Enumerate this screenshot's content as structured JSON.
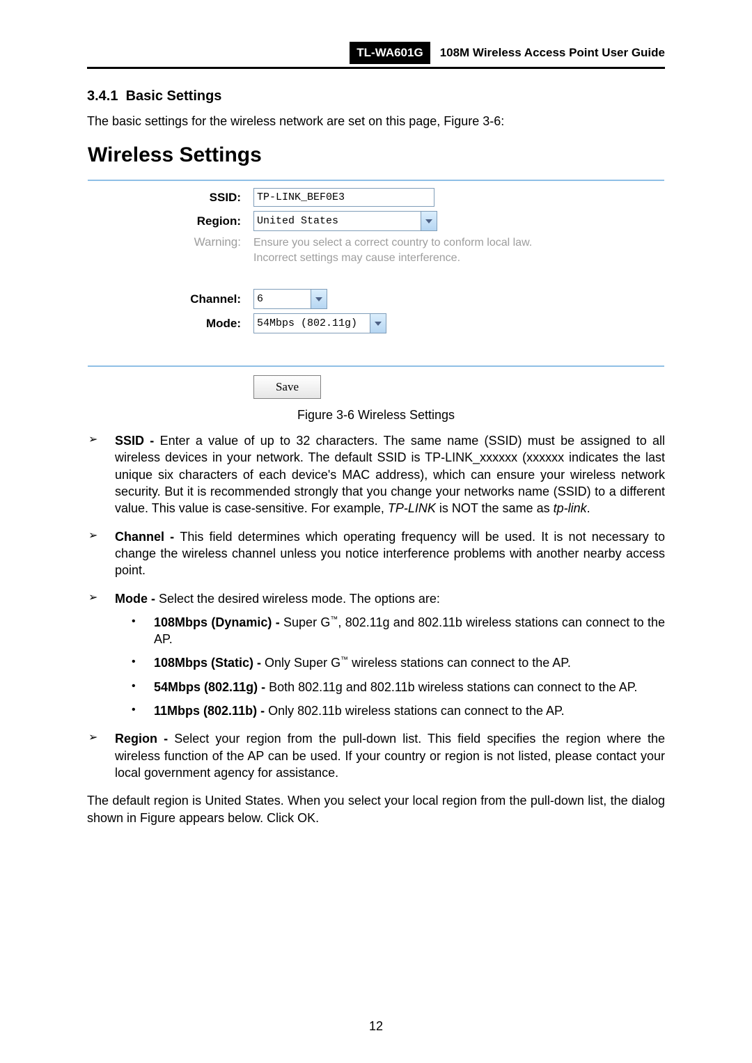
{
  "header": {
    "model": "TL-WA601G",
    "title": "108M Wireless Access Point User Guide"
  },
  "section": {
    "number": "3.4.1",
    "title": "Basic Settings"
  },
  "intro": "The basic settings for the wireless network are set on this page, Figure 3-6:",
  "figure": {
    "title": "Wireless Settings",
    "labels": {
      "ssid": "SSID:",
      "region": "Region:",
      "warning": "Warning:",
      "channel": "Channel:",
      "mode": "Mode:"
    },
    "values": {
      "ssid": "TP-LINK_BEF0E3",
      "region": "United States",
      "channel": "6",
      "mode": "54Mbps (802.11g)"
    },
    "warning_text": "Ensure you select a correct country to conform local law. Incorrect settings may cause interference.",
    "save": "Save",
    "caption": "Figure 3-6 Wireless Settings"
  },
  "bullets": {
    "ssid": {
      "label": "SSID - ",
      "text1": "Enter a value of up to 32 characters. The same name (SSID) must be assigned to all wireless devices in your network. The default SSID is TP-LINK_xxxxxx (xxxxxx indicates the last unique six characters of each device's MAC address), which can ensure your wireless network security. But it is recommended strongly that you change your networks name (SSID) to a different value. This value is case-sensitive. For example, ",
      "italic1": "TP-LINK",
      "text2": " is NOT the same as ",
      "italic2": "tp-link",
      "text3": "."
    },
    "channel": {
      "label": "Channel - ",
      "text": "This field determines which operating frequency will be used. It is not necessary to change the wireless channel unless you notice interference problems with another nearby access point."
    },
    "mode": {
      "label": "Mode - ",
      "text": "Select the desired wireless mode. The options are:",
      "items": [
        {
          "label": "108Mbps (Dynamic) - ",
          "tail": ", 802.11g and 802.11b wireless stations can connect to the AP.",
          "prefix": "Super G"
        },
        {
          "label": "108Mbps (Static) - ",
          "prefix": "Only Super G",
          "tail": " wireless stations can connect to the AP."
        },
        {
          "label": "54Mbps (802.11g) - ",
          "plain": "Both 802.11g and 802.11b wireless stations can connect to the AP."
        },
        {
          "label": "11Mbps (802.11b) - ",
          "plain": "Only 802.11b wireless stations can connect to the AP."
        }
      ]
    },
    "region": {
      "label": "Region - ",
      "text": "Select your region from the pull-down list. This field specifies the region where the wireless function of the AP can be used. If your country or region is not listed, please contact your local government agency for assistance."
    }
  },
  "closing": "The default region is United States. When you select your local region from the pull-down list, the dialog shown in Figure appears below. Click OK.",
  "page_number": "12"
}
